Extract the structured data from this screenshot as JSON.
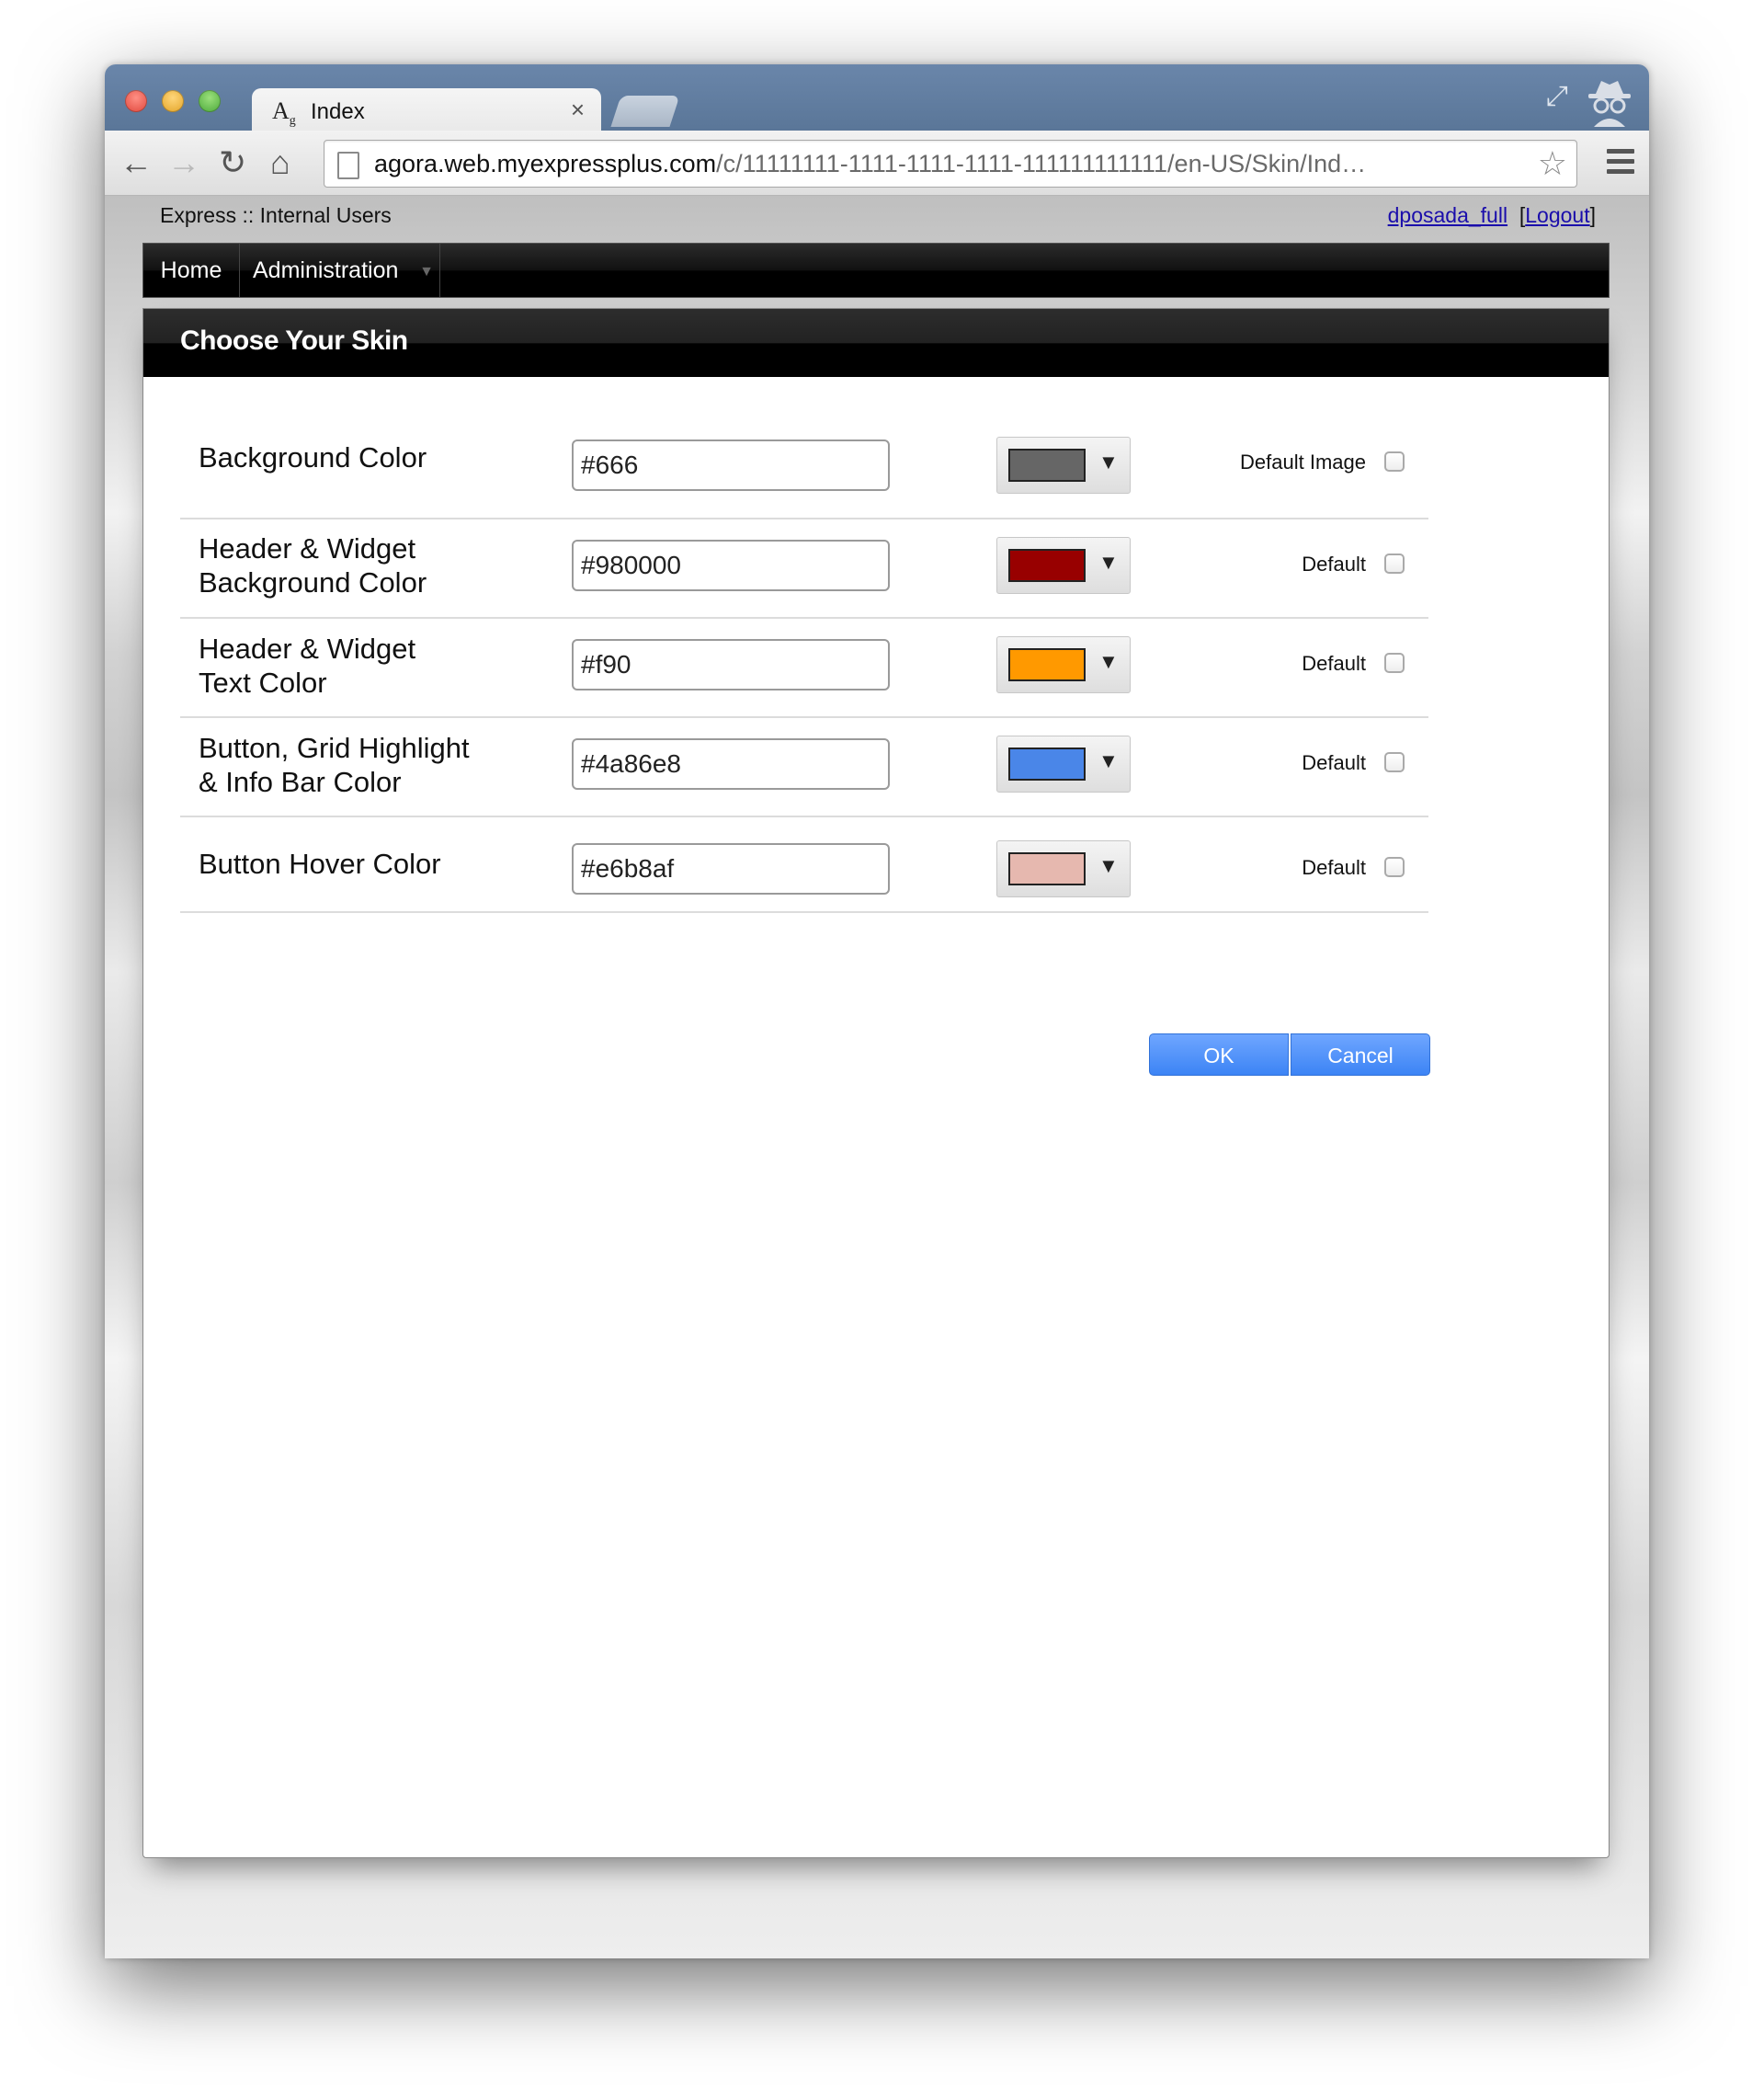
{
  "browser": {
    "tab_icon_main": "A",
    "tab_icon_sub": "g",
    "tab_title": "Index",
    "tab_close": "×",
    "url_host": "agora.web.myexpressplus.com",
    "url_path": "/c/11111111-1111-1111-1111-111111111111/en-US/Skin/Ind…",
    "icons": {
      "back": "←",
      "forward": "→",
      "reload": "↻",
      "home": "⌂",
      "star": "☆",
      "fullscreen": "⤢"
    }
  },
  "app": {
    "title": "Express :: Internal Users",
    "user": "dposada_full",
    "logout": "Logout",
    "bracket_open": "[",
    "bracket_close": "]"
  },
  "menu": {
    "home": "Home",
    "administration": "Administration",
    "caret": "▼"
  },
  "panel": {
    "title": "Choose Your Skin"
  },
  "rows": [
    {
      "label_line1": "Background Color",
      "label_line2": "",
      "value": "#666",
      "swatch": "#666666",
      "default_label": "Default Image"
    },
    {
      "label_line1": "Header & Widget",
      "label_line2": "Background Color",
      "value": "#980000",
      "swatch": "#980000",
      "default_label": "Default"
    },
    {
      "label_line1": "Header & Widget",
      "label_line2": "Text Color",
      "value": "#f90",
      "swatch": "#ff9900",
      "default_label": "Default"
    },
    {
      "label_line1": "Button, Grid Highlight",
      "label_line2": "& Info Bar Color",
      "value": "#4a86e8",
      "swatch": "#4a86e8",
      "default_label": "Default"
    },
    {
      "label_line1": "Button Hover Color",
      "label_line2": "",
      "value": "#e6b8af",
      "swatch": "#e6b8af",
      "default_label": "Default"
    }
  ],
  "swatch_caret": "▼",
  "buttons": {
    "ok": "OK",
    "cancel": "Cancel"
  }
}
